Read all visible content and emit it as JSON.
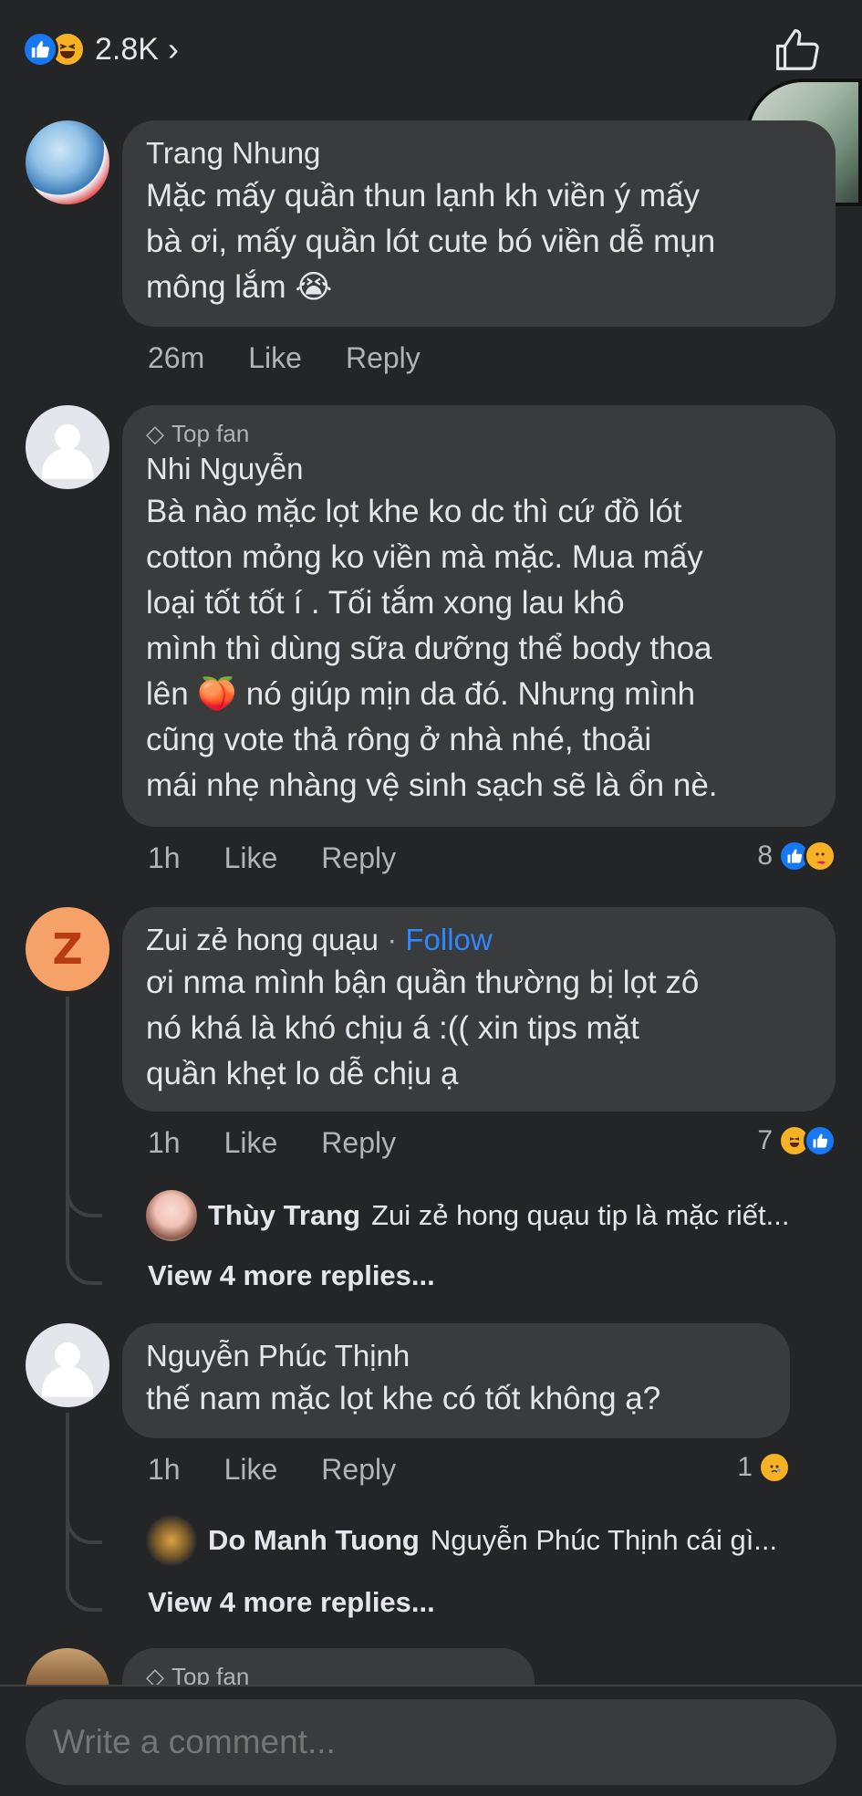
{
  "header": {
    "reaction_count": "2.8K",
    "chevron": "›"
  },
  "comments": [
    {
      "name": "Trang Nhung",
      "text_lines": [
        "Mặc mấy quần thun lạnh kh viền ý mấy",
        "bà ơi, mấy quần lót cute bó viền dễ mụn",
        "mông lắm 😭"
      ],
      "time": "26m",
      "like": "Like",
      "reply": "Reply"
    },
    {
      "badge": "Top fan",
      "name": "Nhi Nguyễn",
      "text_lines": [
        "Bà nào mặc lọt khe ko dc thì cứ đồ lót",
        "cotton mỏng ko viền mà mặc. Mua mấy",
        "loại tốt tốt í . Tối tắm xong lau khô",
        "mình thì dùng sữa dưỡng thể body thoa",
        "lên 🍑 nó giúp mịn da đó. Nhưng mình",
        "cũng vote thả rông ở nhà nhé, thoải",
        "mái nhẹ nhàng vệ sinh sạch sẽ là ổn nè."
      ],
      "time": "1h",
      "like": "Like",
      "reply": "Reply",
      "reaction_count": "8"
    },
    {
      "avatar_letter": "Z",
      "name": "Zui zẻ hong quạu",
      "separator": "·",
      "follow": "Follow",
      "text_lines": [
        "ơi nma mình bận quần thường bị lọt zô",
        "nó khá là khó chịu á :(( xin tips mặt",
        "quần khẹt lo dễ chịu ạ"
      ],
      "time": "1h",
      "like": "Like",
      "reply": "Reply",
      "reaction_count": "7",
      "preview_reply": {
        "name": "Thùy Trang",
        "text": "Zui zẻ hong quạu tip là mặc riết..."
      },
      "more_replies": "View 4 more replies..."
    },
    {
      "name": "Nguyễn Phúc Thịnh",
      "text_lines": [
        "thế nam mặc lọt khe có tốt không ạ?"
      ],
      "time": "1h",
      "like": "Like",
      "reply": "Reply",
      "reaction_count": "1",
      "preview_reply": {
        "name": "Do Manh Tuong",
        "text": "Nguyễn Phúc Thịnh cái gì..."
      },
      "more_replies": "View 4 more replies..."
    },
    {
      "badge": "Top fan"
    }
  ],
  "composer": {
    "placeholder": "Write a comment..."
  }
}
